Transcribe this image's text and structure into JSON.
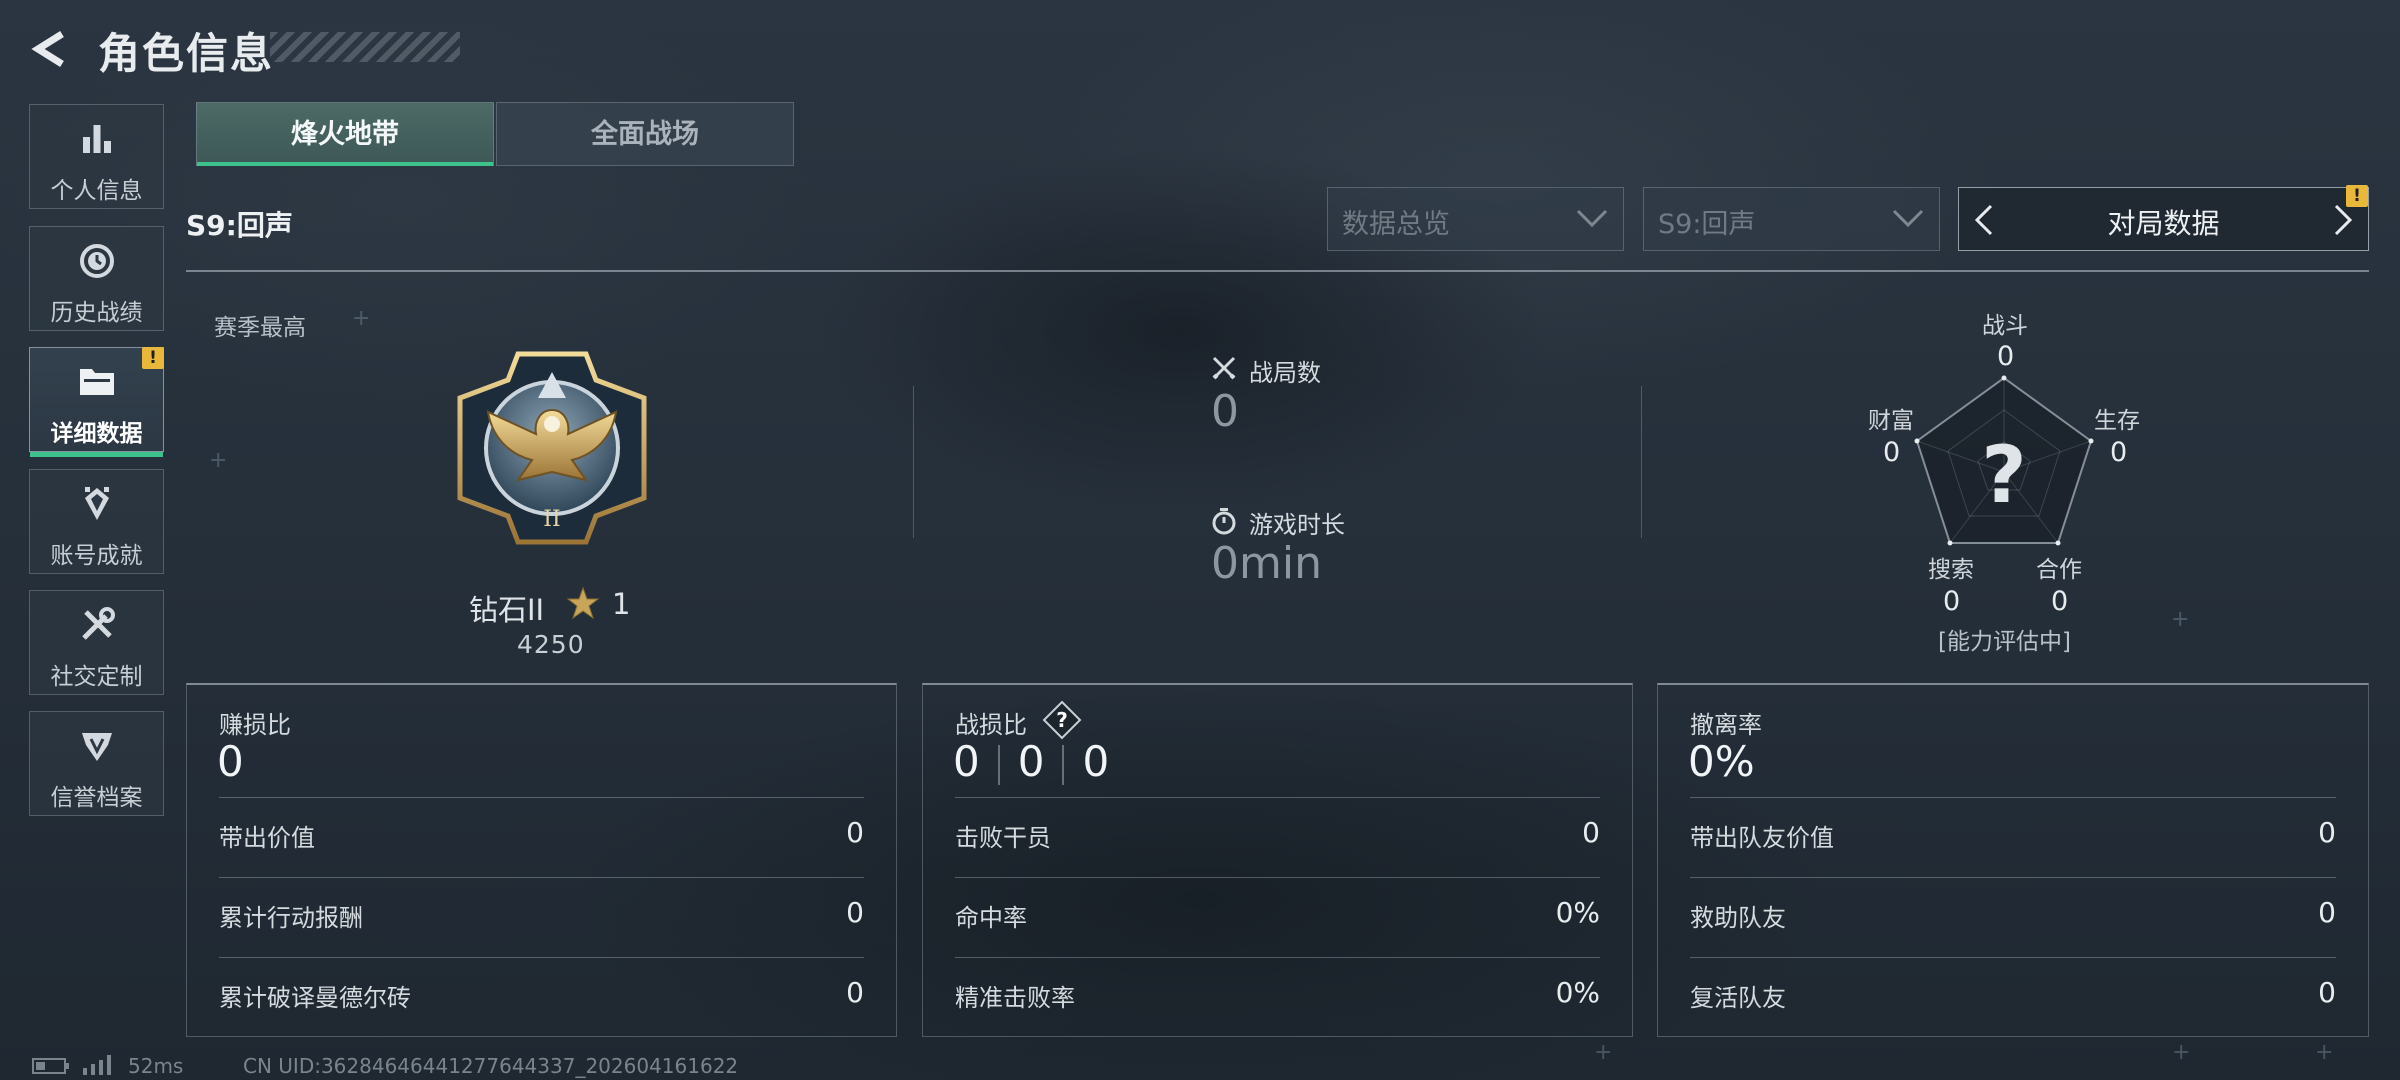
{
  "header": {
    "title": "角色信息"
  },
  "sidebar": {
    "items": [
      {
        "label": "个人信息",
        "icon": "bar-chart-icon"
      },
      {
        "label": "历史战绩",
        "icon": "history-icon"
      },
      {
        "label": "详细数据",
        "icon": "folder-icon",
        "active": true,
        "badge": "!"
      },
      {
        "label": "账号成就",
        "icon": "achievement-icon"
      },
      {
        "label": "社交定制",
        "icon": "tools-icon"
      },
      {
        "label": "信誉档案",
        "icon": "reputation-icon"
      }
    ]
  },
  "tabs": [
    {
      "label": "烽火地带",
      "active": true
    },
    {
      "label": "全面战场",
      "active": false
    }
  ],
  "season_label": "S9:回声",
  "filters": {
    "overview_placeholder": "数据总览",
    "season_placeholder": "S9:回声",
    "match_label": "对局数据",
    "match_badge": "!"
  },
  "rank": {
    "section_label": "赛季最高",
    "name": "钻石II",
    "stars": "1",
    "score": "4250",
    "badge_numeral": "II"
  },
  "match_stats": {
    "matches_label": "战局数",
    "matches_value": "0",
    "time_label": "游戏时长",
    "time_value": "0min"
  },
  "radar": {
    "center_mark": "?",
    "status": "[能力评估中]",
    "axes": [
      {
        "label": "战斗",
        "value": "0"
      },
      {
        "label": "生存",
        "value": "0"
      },
      {
        "label": "合作",
        "value": "0"
      },
      {
        "label": "搜索",
        "value": "0"
      },
      {
        "label": "财富",
        "value": "0"
      }
    ]
  },
  "panels": {
    "profit": {
      "title": "赚损比",
      "value": "0",
      "rows": [
        {
          "label": "带出价值",
          "value": "0"
        },
        {
          "label": "累计行动报酬",
          "value": "0"
        },
        {
          "label": "累计破译曼德尔砖",
          "value": "0"
        }
      ]
    },
    "combat": {
      "title": "战损比",
      "help": "?",
      "values": [
        "0",
        "0",
        "0"
      ],
      "rows": [
        {
          "label": "击败干员",
          "value": "0"
        },
        {
          "label": "命中率",
          "value": "0%"
        },
        {
          "label": "精准击败率",
          "value": "0%"
        }
      ]
    },
    "extract": {
      "title": "撤离率",
      "value": "0%",
      "rows": [
        {
          "label": "带出队友价值",
          "value": "0"
        },
        {
          "label": "救助队友",
          "value": "0"
        },
        {
          "label": "复活队友",
          "value": "0"
        }
      ]
    }
  },
  "footer": {
    "ping": "52ms",
    "uid": "CN UID:362846464412776443​37_202604161622"
  },
  "colors": {
    "accent": "#3cc28a",
    "warning": "#e9b83a",
    "background": "#26303b"
  }
}
